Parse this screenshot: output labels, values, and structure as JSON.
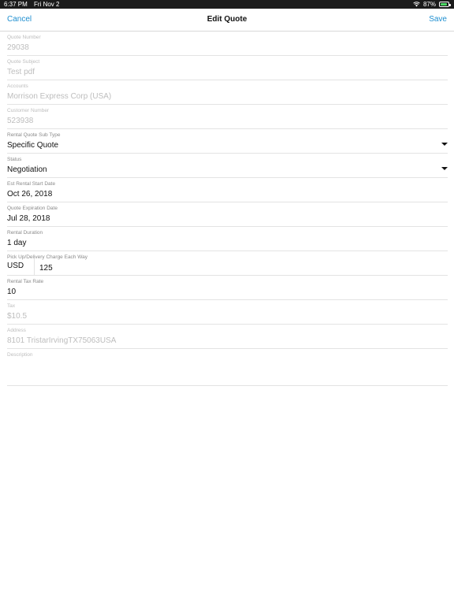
{
  "status_bar": {
    "time": "6:37 PM",
    "date": "Fri Nov 2",
    "battery_percent": "87%",
    "battery_level": 0.87
  },
  "nav": {
    "cancel_label": "Cancel",
    "title": "Edit Quote",
    "save_label": "Save"
  },
  "fields": {
    "quote_number": {
      "label": "Quote Number",
      "value": "29038"
    },
    "quote_subject": {
      "label": "Quote Subject",
      "value": "Test pdf"
    },
    "accounts": {
      "label": "Accounts",
      "value": "Morrison Express Corp (USA)"
    },
    "customer_number": {
      "label": "Customer Number",
      "value": "523938"
    },
    "rental_quote_sub_type": {
      "label": "Rental Quote Sub Type",
      "value": "Specific Quote"
    },
    "status": {
      "label": "Status",
      "value": "Negotiation"
    },
    "est_rental_start_date": {
      "label": "Est Rental Start Date",
      "value": "Oct 26, 2018"
    },
    "quote_expiration_date": {
      "label": "Quote Expiration Date",
      "value": "Jul 28, 2018"
    },
    "rental_duration": {
      "label": "Rental Duration",
      "value": "1 day"
    },
    "pickup_delivery_charge": {
      "label": "Pick Up/Delivery Charge Each Way",
      "currency": "USD",
      "value": "125"
    },
    "rental_tax_rate": {
      "label": "Rental Tax Rate",
      "value": "10"
    },
    "tax": {
      "label": "Tax",
      "value": "$10.5"
    },
    "address": {
      "label": "Address",
      "value": "8101 TristarIrvingTX75063USA"
    },
    "description": {
      "label": "Description",
      "value": ""
    }
  },
  "colors": {
    "accent": "#1f8fd0",
    "disabled_text": "#bdbdbd",
    "label_text": "#8a8a8a",
    "status_bar_bg": "#1b1b1b"
  }
}
